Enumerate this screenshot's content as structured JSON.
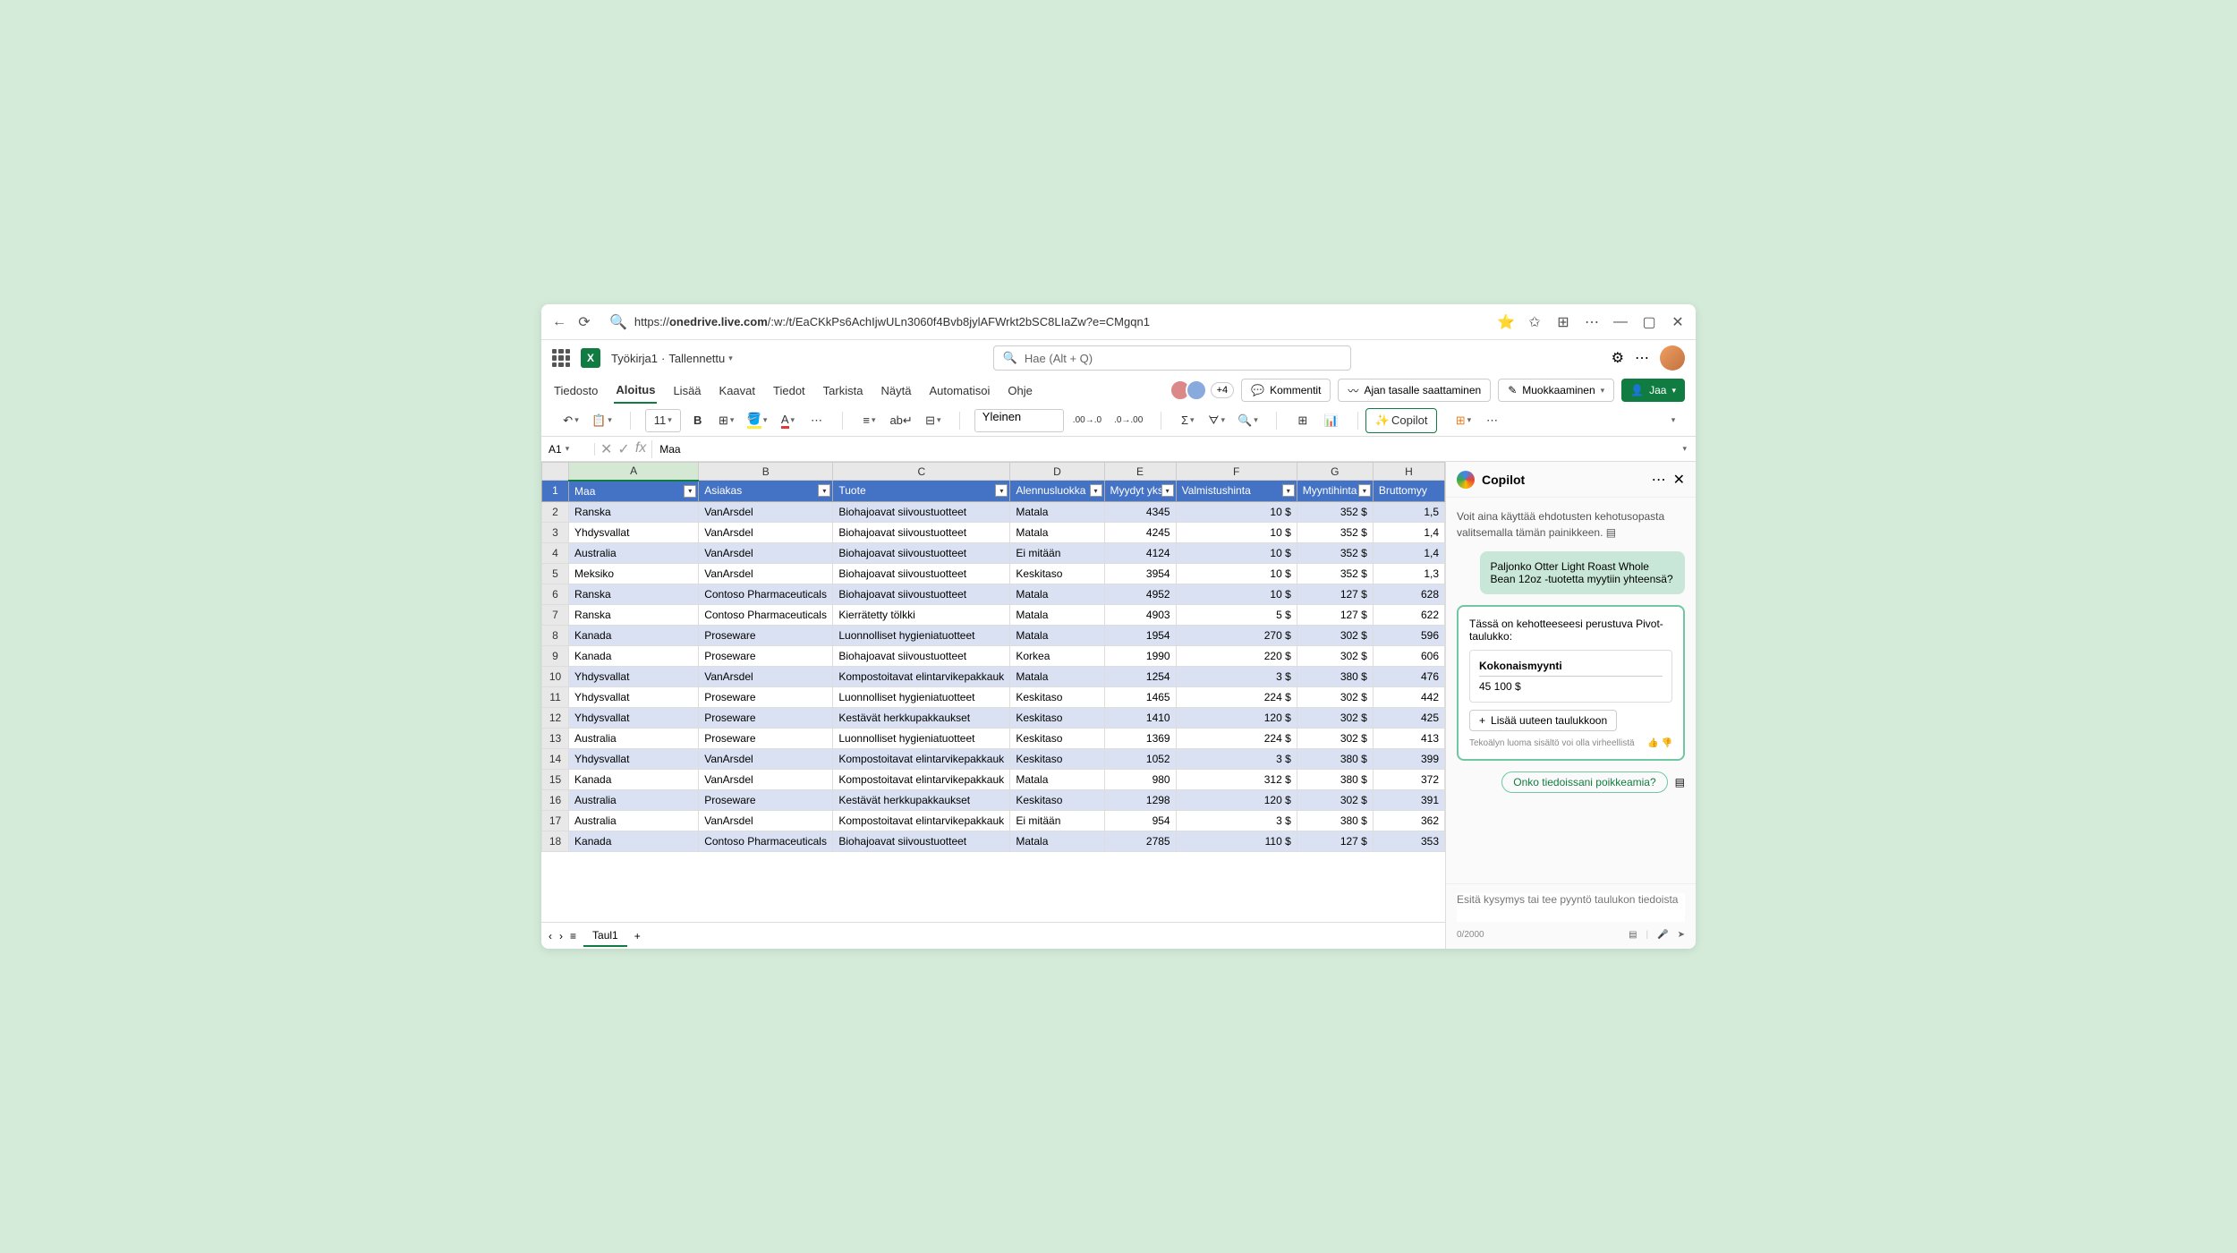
{
  "browser": {
    "url_domain": "onedrive.live.com",
    "url_path": "/:w:/t/EaCKkPs6AchIjwULn3060f4Bvb8jylAFWrkt2bSC8LIaZw?e=CMgqn1"
  },
  "app": {
    "doc_name": "Työkirja1",
    "save_status": "Tallennettu",
    "search_placeholder": "Hae (Alt + Q)"
  },
  "ribbon": {
    "tabs": [
      "Tiedosto",
      "Aloitus",
      "Lisää",
      "Kaavat",
      "Tiedot",
      "Tarkista",
      "Näytä",
      "Automatisoi",
      "Ohje"
    ],
    "presence_more": "+4",
    "comments": "Kommentit",
    "catchup": "Ajan tasalle saattaminen",
    "editing": "Muokkaaminen",
    "share": "Jaa"
  },
  "toolbar": {
    "font_size": "11",
    "number_format": "Yleinen",
    "copilot": "Copilot"
  },
  "formula_bar": {
    "cell_ref": "A1",
    "value": "Maa"
  },
  "columns": [
    "A",
    "B",
    "C",
    "D",
    "E",
    "F",
    "G",
    "H"
  ],
  "headers": [
    "Maa",
    "Asiakas",
    "Tuote",
    "Alennusluokka",
    "Myydyt yksi",
    "Valmistushinta",
    "Myyntihinta",
    "Bruttomyy"
  ],
  "rows": [
    [
      "Ranska",
      "VanArsdel",
      "Biohajoavat siivoustuotteet",
      "Matala",
      "4345",
      "10 $",
      "352 $",
      "1,5"
    ],
    [
      "Yhdysvallat",
      "VanArsdel",
      "Biohajoavat siivoustuotteet",
      "Matala",
      "4245",
      "10 $",
      "352 $",
      "1,4"
    ],
    [
      "Australia",
      "VanArsdel",
      "Biohajoavat siivoustuotteet",
      "Ei mitään",
      "4124",
      "10 $",
      "352 $",
      "1,4"
    ],
    [
      "Meksiko",
      "VanArsdel",
      "Biohajoavat siivoustuotteet",
      "Keskitaso",
      "3954",
      "10 $",
      "352 $",
      "1,3"
    ],
    [
      "Ranska",
      "Contoso Pharmaceuticals",
      "Biohajoavat siivoustuotteet",
      "Matala",
      "4952",
      "10 $",
      "127 $",
      "628"
    ],
    [
      "Ranska",
      "Contoso Pharmaceuticals",
      "Kierrätetty tölkki",
      "Matala",
      "4903",
      "5 $",
      "127 $",
      "622"
    ],
    [
      "Kanada",
      "Proseware",
      "Luonnolliset hygieniatuotteet",
      "Matala",
      "1954",
      "270 $",
      "302 $",
      "596"
    ],
    [
      "Kanada",
      "Proseware",
      "Biohajoavat siivoustuotteet",
      "Korkea",
      "1990",
      "220 $",
      "302 $",
      "606"
    ],
    [
      "Yhdysvallat",
      "VanArsdel",
      "Kompostoitavat elintarvikepakkauk",
      "Matala",
      "1254",
      "3 $",
      "380 $",
      "476"
    ],
    [
      "Yhdysvallat",
      "Proseware",
      "Luonnolliset hygieniatuotteet",
      "Keskitaso",
      "1465",
      "224 $",
      "302 $",
      "442"
    ],
    [
      "Yhdysvallat",
      "Proseware",
      "Kestävät herkkupakkaukset",
      "Keskitaso",
      "1410",
      "120 $",
      "302 $",
      "425"
    ],
    [
      "Australia",
      "Proseware",
      "Luonnolliset hygieniatuotteet",
      "Keskitaso",
      "1369",
      "224 $",
      "302 $",
      "413"
    ],
    [
      "Yhdysvallat",
      "VanArsdel",
      "Kompostoitavat elintarvikepakkauk",
      "Keskitaso",
      "1052",
      "3 $",
      "380 $",
      "399"
    ],
    [
      "Kanada",
      "VanArsdel",
      "Kompostoitavat elintarvikepakkauk",
      "Matala",
      "980",
      "312 $",
      "380 $",
      "372"
    ],
    [
      "Australia",
      "Proseware",
      "Kestävät herkkupakkaukset",
      "Keskitaso",
      "1298",
      "120 $",
      "302 $",
      "391"
    ],
    [
      "Australia",
      "VanArsdel",
      "Kompostoitavat elintarvikepakkauk",
      "Ei mitään",
      "954",
      "3 $",
      "380 $",
      "362"
    ],
    [
      "Kanada",
      "Contoso Pharmaceuticals",
      "Biohajoavat siivoustuotteet",
      "Matala",
      "2785",
      "110 $",
      "127 $",
      "353"
    ]
  ],
  "sheet_tab": "Taul1",
  "copilot_pane": {
    "title": "Copilot",
    "hint": "Voit aina käyttää ehdotusten kehotusopasta valitsemalla tämän painikkeen.",
    "user_message": "Paljonko Otter Light Roast Whole Bean 12oz -tuotetta myytiin yhteensä?",
    "ai_intro": "Tässä on kehotteeseesi perustuva Pivot-taulukko:",
    "pivot_label": "Kokonaismyynti",
    "pivot_value": "45 100 $",
    "add_button": "Lisää uuteen taulukkoon",
    "disclaimer": "Tekoälyn luoma sisältö voi olla virheellistä",
    "suggestion": "Onko tiedoissani poikkeamia?",
    "input_placeholder": "Esitä kysymys tai tee pyyntö taulukon tiedoista",
    "char_count": "0/2000"
  }
}
